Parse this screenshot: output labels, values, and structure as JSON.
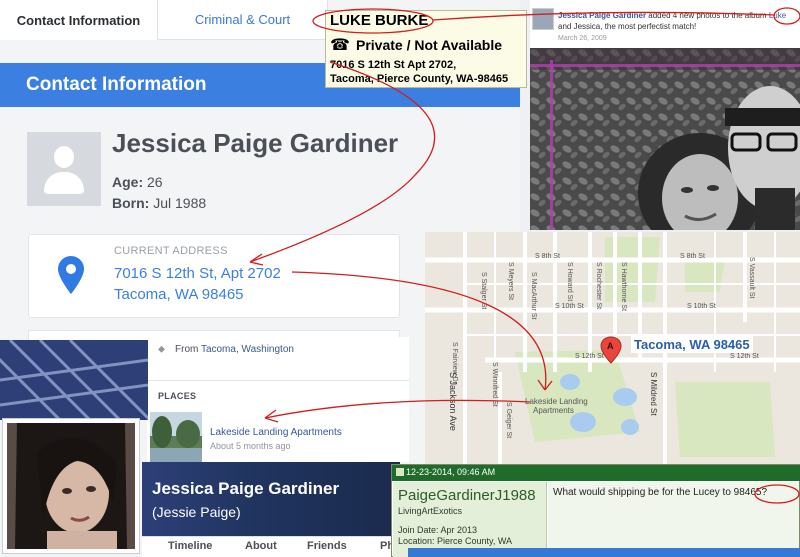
{
  "tabs": [
    {
      "label": "Contact Information"
    },
    {
      "label": "Criminal & Court"
    }
  ],
  "section_header": "Contact Information",
  "profile": {
    "name": "Jessica Paige Gardiner",
    "age_label": "Age:",
    "age_value": "26",
    "born_label": "Born:",
    "born_value": "Jul 1988"
  },
  "current_address": {
    "label": "CURRENT ADDRESS",
    "line1": "7016 S 12th St, Apt 2702",
    "line2": "Tacoma, WA 98465"
  },
  "tooltip": {
    "name": "LUKE BURKE",
    "phone_icon": "☎",
    "phone": "Private / Not Available",
    "address_line1": "7016 S 12th St Apt 2702,",
    "address_line2": "Tacoma, Pierce County, WA-98465"
  },
  "fb_post": {
    "author": "Jessica Paige Gardiner",
    "text": " added 4 new photos to the album ",
    "album": "Luke",
    "text2": "and Jessica, the most perfectist match!",
    "date": "March 26, 2009"
  },
  "map": {
    "pin_letter": "A",
    "city_label": "Tacoma, WA 98465",
    "place_label_1": "Lakeside Landing",
    "place_label_2": "Apartments",
    "streets": {
      "s8th_a": "S 8th St",
      "s8th_b": "S 8th St",
      "s10th_a": "S 10th St",
      "s10th_b": "S 10th St",
      "s12th_a": "S 12th St",
      "s12th_b": "S 12th St",
      "meyers": "S Meyers St",
      "stalger": "S Stalger St",
      "mackinnon": "S MacArthur St",
      "howard": "S Howard St",
      "rochester": "S Rochester St",
      "hawthorne": "S Hawthorne St",
      "vassault": "S Vassault St",
      "fairview": "S Fairview Dr",
      "jackson": "S Jackson Ave",
      "geiger": "S Geiger St",
      "mildred": "S Mildred St",
      "winnifred": "S Winnifred St"
    }
  },
  "fb_profile": {
    "from_prefix": "From ",
    "from_location": "Tacoma, Washington",
    "places_header": "PLACES",
    "place_name": "Lakeside Landing Apartments",
    "place_time": "About 5 months ago",
    "name": "Jessica Paige Gardiner",
    "nickname": "(Jessie Paige)",
    "tabs": [
      "Timeline",
      "About",
      "Friends",
      "Phot"
    ]
  },
  "forum": {
    "date": "12-23-2014, 09:46 AM",
    "username": "PaigeGardinerJ1988",
    "shop": "LivingArtExotics",
    "join": "Join Date: Apr 2013",
    "location": "Location: Pierce County, WA",
    "message": "What would shipping be for the Lucey to 98465?"
  },
  "colors": {
    "brand_blue": "#3b80e0",
    "annotation_red": "#d41c1c",
    "forum_green": "#1f6b2a",
    "facebook_blue": "#365899"
  }
}
